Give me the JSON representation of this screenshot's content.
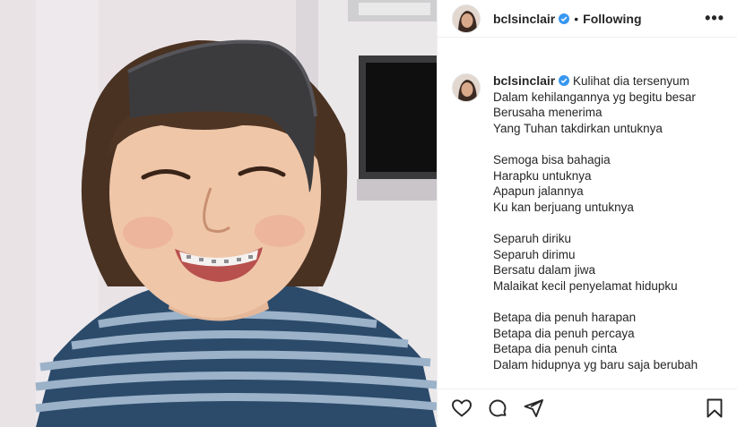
{
  "post": {
    "username": "bclsinclair",
    "follow_status": "Following",
    "separator": "•",
    "more_label": "•••"
  },
  "caption": {
    "first_line": "Kulihat dia tersenyum",
    "stanzas": [
      [
        "Dalam kehilangannya yg begitu besar",
        "Berusaha menerima",
        "Yang Tuhan takdirkan untuknya"
      ],
      [
        "Semoga bisa bahagia",
        "Harapku untuknya",
        "Apapun jalannya",
        "Ku kan berjuang untuknya"
      ],
      [
        "Separuh diriku",
        "Separuh dirimu",
        "Bersatu dalam jiwa",
        "Malaikat kecil penyelamat hidupku"
      ],
      [
        "Betapa dia penuh harapan",
        "Betapa dia penuh percaya",
        "Betapa dia penuh cinta",
        "Dalam hidupnya yg baru saja berubah"
      ]
    ]
  },
  "icons": {
    "verified": "verified-badge-icon",
    "like": "heart-icon",
    "comment": "comment-icon",
    "share": "paper-plane-icon",
    "save": "bookmark-icon"
  },
  "colors": {
    "verified": "#3897f0",
    "text": "#262626",
    "divider": "#efefef"
  }
}
